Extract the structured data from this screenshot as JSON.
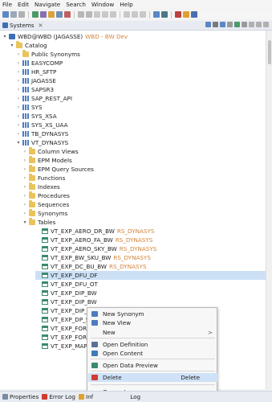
{
  "menu": [
    "File",
    "Edit",
    "Navigate",
    "Search",
    "Window",
    "Help"
  ],
  "view": {
    "tab_label": "Systems",
    "tab_close": "✕"
  },
  "tree": {
    "system": {
      "name": "WBD@WBD (JAGASSE)",
      "suffix": "WBD - BW Dev"
    },
    "catalog": "Catalog",
    "top_items": [
      "Public Synonyms",
      "EASYCOMP",
      "HR_SFTP",
      "JAGASSE",
      "SAPSR3",
      "SAP_REST_API",
      "SYS",
      "SYS_XSA",
      "SYS_XS_UAA",
      "TB_DYNASYS",
      "VT_DYNASYS"
    ],
    "vt_children": [
      "Column Views",
      "EPM Models",
      "EPM Query Sources",
      "Functions",
      "Indexes",
      "Procedures",
      "Sequences",
      "Synonyms",
      "Tables"
    ],
    "schema_tag": "RS_DYNASYS",
    "tables": [
      {
        "name": "VT_EXP_AERO_DR_BW",
        "tag": "RS_DYNASYS"
      },
      {
        "name": "VT_EXP_AERO_FA_BW",
        "tag": "RS_DYNASYS"
      },
      {
        "name": "VT_EXP_AERO_SKY_BW",
        "tag": "RS_DYNASYS"
      },
      {
        "name": "VT_EXP_BW_SKU_BW",
        "tag": "RS_DYNASYS"
      },
      {
        "name": "VT_EXP_DC_BU_BW",
        "tag": "RS_DYNASYS"
      },
      {
        "name": "VT_EXP_DFU_DF",
        "tag": ""
      },
      {
        "name": "VT_EXP_DFU_OT",
        "tag": ""
      },
      {
        "name": "VT_EXP_DIP_BW",
        "tag": ""
      },
      {
        "name": "VT_EXP_DIP_BW",
        "tag": ""
      },
      {
        "name": "VT_EXP_DIP_BW",
        "tag": ""
      },
      {
        "name": "VT_EXP_DP_SHIF",
        "tag": ""
      },
      {
        "name": "VT_EXP_FORE_B",
        "tag": ""
      },
      {
        "name": "VT_EXP_FORE_D",
        "tag": ""
      },
      {
        "name": "VT_EXP_MAPL_F",
        "tag": ""
      }
    ]
  },
  "context_menu": {
    "items": [
      {
        "label": "New Synonym",
        "accel": "",
        "sub": "",
        "icon": "synonym-icon",
        "color": "#4a7cc0"
      },
      {
        "label": "New View",
        "accel": "",
        "sub": "",
        "icon": "view-icon",
        "color": "#4a7cc0"
      },
      {
        "label": "New",
        "accel": "",
        "sub": ">",
        "icon": "",
        "color": ""
      },
      {
        "label": "Open Definition",
        "accel": "",
        "sub": "",
        "icon": "definition-icon",
        "color": "#5b6f9a"
      },
      {
        "label": "Open Content",
        "accel": "",
        "sub": "",
        "icon": "content-icon",
        "color": "#3d7ab8"
      },
      {
        "label": "Open Data Preview",
        "accel": "",
        "sub": "",
        "icon": "preview-icon",
        "color": "#3a8a6e"
      },
      {
        "label": "Delete",
        "accel": "Delete",
        "sub": "",
        "icon": "delete-icon",
        "color": "#d23b2f"
      },
      {
        "label": "Generate",
        "accel": "",
        "sub": ">",
        "icon": "",
        "color": ""
      }
    ]
  },
  "status_tabs": [
    "Properties",
    "Error Log",
    "Inf",
    "Log"
  ],
  "colors": {
    "selection": "#cce0f5",
    "schema_tag": "#d2843c",
    "menu_highlight": "#cfe2f7"
  }
}
